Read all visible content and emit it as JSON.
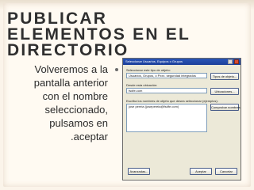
{
  "slide": {
    "title_lines": [
      "PUBLICAR",
      "ELEMENTOS EN EL",
      "DIRECTORIO"
    ],
    "body_lines": [
      "Volveremos a la",
      "pantalla anterior",
      "con el nombre",
      "seleccionado,",
      "pulsamos en",
      ".aceptar"
    ]
  },
  "dialog": {
    "title": "Seleccionar Usuarios, Equipos o Grupos",
    "object_type_label": "Seleccionar este tipo de objeto:",
    "object_type_value": "Usuarios, Grupos, o Pxxx. seguridad integrados",
    "object_types_button": "Tipos de objeto...",
    "location_label": "Desde esta ubicación:",
    "location_value": "fsdfe.com",
    "locations_button": "Ubicaciones...",
    "names_label": "Escriba los nombres de objeto que desea seleccionar (ejemplos):",
    "names_value": "jose pereia (josepereia@fsdfe.com)",
    "check_names_button": "Comprobar nombres",
    "advanced_button": "Avanzadas...",
    "ok_button": "Aceptar",
    "cancel_button": "Cancelar"
  }
}
